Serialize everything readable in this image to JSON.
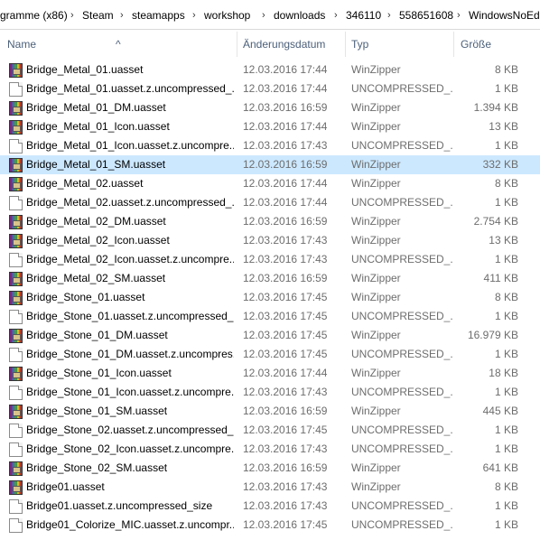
{
  "breadcrumb": [
    "gramme (x86)",
    "Steam",
    "steamapps",
    "workshop",
    "downloads",
    "346110",
    "558651608",
    "WindowsNoEd"
  ],
  "columns": {
    "name": "Name",
    "date": "Änderungsdatum",
    "type": "Typ",
    "size": "Größe"
  },
  "files": [
    {
      "name": "Bridge_Metal_01.uasset",
      "date": "12.03.2016 17:44",
      "type": "WinZipper",
      "size": "8 KB",
      "icon": "winzipper-archive-icon"
    },
    {
      "name": "Bridge_Metal_01.uasset.z.uncompressed_...",
      "date": "12.03.2016 17:44",
      "type": "UNCOMPRESSED_...",
      "size": "1 KB",
      "icon": "blank-file-icon"
    },
    {
      "name": "Bridge_Metal_01_DM.uasset",
      "date": "12.03.2016 16:59",
      "type": "WinZipper",
      "size": "1.394 KB",
      "icon": "winzipper-archive-icon"
    },
    {
      "name": "Bridge_Metal_01_Icon.uasset",
      "date": "12.03.2016 17:44",
      "type": "WinZipper",
      "size": "13 KB",
      "icon": "winzipper-archive-icon"
    },
    {
      "name": "Bridge_Metal_01_Icon.uasset.z.uncompre...",
      "date": "12.03.2016 17:43",
      "type": "UNCOMPRESSED_...",
      "size": "1 KB",
      "icon": "blank-file-icon"
    },
    {
      "name": "Bridge_Metal_01_SM.uasset",
      "date": "12.03.2016 16:59",
      "type": "WinZipper",
      "size": "332 KB",
      "icon": "winzipper-archive-icon",
      "selected": true
    },
    {
      "name": "Bridge_Metal_02.uasset",
      "date": "12.03.2016 17:44",
      "type": "WinZipper",
      "size": "8 KB",
      "icon": "winzipper-archive-icon"
    },
    {
      "name": "Bridge_Metal_02.uasset.z.uncompressed_...",
      "date": "12.03.2016 17:44",
      "type": "UNCOMPRESSED_...",
      "size": "1 KB",
      "icon": "blank-file-icon"
    },
    {
      "name": "Bridge_Metal_02_DM.uasset",
      "date": "12.03.2016 16:59",
      "type": "WinZipper",
      "size": "2.754 KB",
      "icon": "winzipper-archive-icon"
    },
    {
      "name": "Bridge_Metal_02_Icon.uasset",
      "date": "12.03.2016 17:43",
      "type": "WinZipper",
      "size": "13 KB",
      "icon": "winzipper-archive-icon"
    },
    {
      "name": "Bridge_Metal_02_Icon.uasset.z.uncompre...",
      "date": "12.03.2016 17:43",
      "type": "UNCOMPRESSED_...",
      "size": "1 KB",
      "icon": "blank-file-icon"
    },
    {
      "name": "Bridge_Metal_02_SM.uasset",
      "date": "12.03.2016 16:59",
      "type": "WinZipper",
      "size": "411 KB",
      "icon": "winzipper-archive-icon"
    },
    {
      "name": "Bridge_Stone_01.uasset",
      "date": "12.03.2016 17:45",
      "type": "WinZipper",
      "size": "8 KB",
      "icon": "winzipper-archive-icon"
    },
    {
      "name": "Bridge_Stone_01.uasset.z.uncompressed_...",
      "date": "12.03.2016 17:45",
      "type": "UNCOMPRESSED_...",
      "size": "1 KB",
      "icon": "blank-file-icon"
    },
    {
      "name": "Bridge_Stone_01_DM.uasset",
      "date": "12.03.2016 17:45",
      "type": "WinZipper",
      "size": "16.979 KB",
      "icon": "winzipper-archive-icon"
    },
    {
      "name": "Bridge_Stone_01_DM.uasset.z.uncompres...",
      "date": "12.03.2016 17:45",
      "type": "UNCOMPRESSED_...",
      "size": "1 KB",
      "icon": "blank-file-icon"
    },
    {
      "name": "Bridge_Stone_01_Icon.uasset",
      "date": "12.03.2016 17:44",
      "type": "WinZipper",
      "size": "18 KB",
      "icon": "winzipper-archive-icon"
    },
    {
      "name": "Bridge_Stone_01_Icon.uasset.z.uncompre...",
      "date": "12.03.2016 17:43",
      "type": "UNCOMPRESSED_...",
      "size": "1 KB",
      "icon": "blank-file-icon"
    },
    {
      "name": "Bridge_Stone_01_SM.uasset",
      "date": "12.03.2016 16:59",
      "type": "WinZipper",
      "size": "445 KB",
      "icon": "winzipper-archive-icon"
    },
    {
      "name": "Bridge_Stone_02.uasset.z.uncompressed_...",
      "date": "12.03.2016 17:45",
      "type": "UNCOMPRESSED_...",
      "size": "1 KB",
      "icon": "blank-file-icon"
    },
    {
      "name": "Bridge_Stone_02_Icon.uasset.z.uncompre...",
      "date": "12.03.2016 17:43",
      "type": "UNCOMPRESSED_...",
      "size": "1 KB",
      "icon": "blank-file-icon"
    },
    {
      "name": "Bridge_Stone_02_SM.uasset",
      "date": "12.03.2016 16:59",
      "type": "WinZipper",
      "size": "641 KB",
      "icon": "winzipper-archive-icon"
    },
    {
      "name": "Bridge01.uasset",
      "date": "12.03.2016 17:43",
      "type": "WinZipper",
      "size": "8 KB",
      "icon": "winzipper-archive-icon"
    },
    {
      "name": "Bridge01.uasset.z.uncompressed_size",
      "date": "12.03.2016 17:43",
      "type": "UNCOMPRESSED_...",
      "size": "1 KB",
      "icon": "blank-file-icon"
    },
    {
      "name": "Bridge01_Colorize_MIC.uasset.z.uncompr...",
      "date": "12.03.2016 17:45",
      "type": "UNCOMPRESSED_...",
      "size": "1 KB",
      "icon": "blank-file-icon"
    }
  ],
  "colors": {
    "selected_row": "#cce8ff",
    "header_text": "#4c607a",
    "secondary_text": "#6d6d6d"
  }
}
